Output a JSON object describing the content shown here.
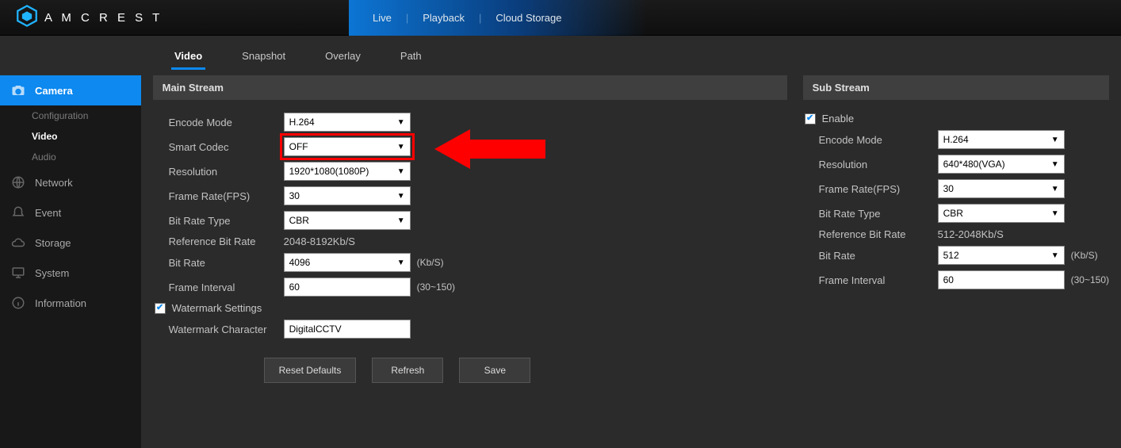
{
  "brand": "A M C R E S T",
  "top_nav": {
    "live": "Live",
    "playback": "Playback",
    "cloud": "Cloud Storage"
  },
  "sub_tabs": {
    "video": "Video",
    "snapshot": "Snapshot",
    "overlay": "Overlay",
    "path": "Path"
  },
  "sidebar": {
    "camera": "Camera",
    "camera_sub": {
      "configuration": "Configuration",
      "video": "Video",
      "audio": "Audio"
    },
    "network": "Network",
    "event": "Event",
    "storage": "Storage",
    "system": "System",
    "information": "Information"
  },
  "main": {
    "header": "Main Stream",
    "encode_mode_label": "Encode Mode",
    "encode_mode": "H.264",
    "smart_codec_label": "Smart Codec",
    "smart_codec": "OFF",
    "resolution_label": "Resolution",
    "resolution": "1920*1080(1080P)",
    "fps_label": "Frame Rate(FPS)",
    "fps": "30",
    "bitrate_type_label": "Bit Rate Type",
    "bitrate_type": "CBR",
    "ref_bitrate_label": "Reference Bit Rate",
    "ref_bitrate": "2048-8192Kb/S",
    "bitrate_label": "Bit Rate",
    "bitrate": "4096",
    "bitrate_suffix": "(Kb/S)",
    "frame_interval_label": "Frame Interval",
    "frame_interval": "60",
    "frame_interval_suffix": "(30~150)",
    "watermark_settings_label": "Watermark Settings",
    "watermark_char_label": "Watermark Character",
    "watermark_char": "DigitalCCTV"
  },
  "sub": {
    "header": "Sub Stream",
    "enable_label": "Enable",
    "encode_mode_label": "Encode Mode",
    "encode_mode": "H.264",
    "resolution_label": "Resolution",
    "resolution": "640*480(VGA)",
    "fps_label": "Frame Rate(FPS)",
    "fps": "30",
    "bitrate_type_label": "Bit Rate Type",
    "bitrate_type": "CBR",
    "ref_bitrate_label": "Reference Bit Rate",
    "ref_bitrate": "512-2048Kb/S",
    "bitrate_label": "Bit Rate",
    "bitrate": "512",
    "bitrate_suffix": "(Kb/S)",
    "frame_interval_label": "Frame Interval",
    "frame_interval": "60",
    "frame_interval_suffix": "(30~150)"
  },
  "buttons": {
    "reset": "Reset Defaults",
    "refresh": "Refresh",
    "save": "Save"
  }
}
